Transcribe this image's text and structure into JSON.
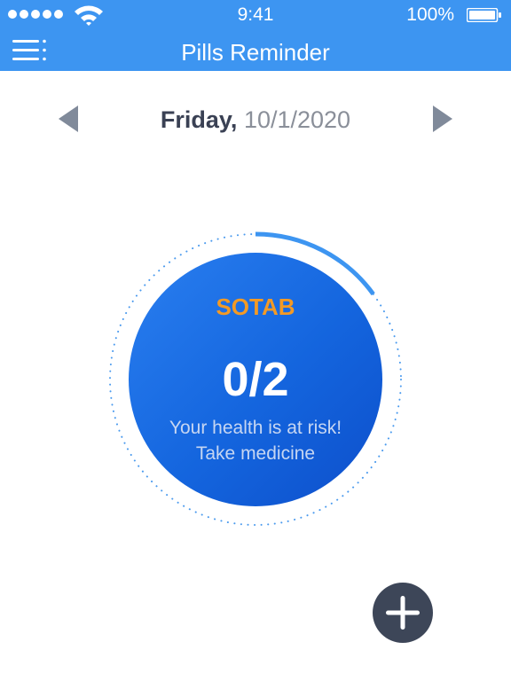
{
  "status_bar": {
    "time": "9:41",
    "battery": "100%"
  },
  "nav_bar": {
    "title": "Pills Reminder"
  },
  "date_nav": {
    "day": "Friday,",
    "date": "10/1/2020"
  },
  "pill_card": {
    "name": "SOTAB",
    "dose_count": "0/2",
    "warning_line_1": "Your health is at risk!",
    "warning_line_2": "Take medicine",
    "progress_fraction": 0.15
  },
  "colors": {
    "header": "#3d95f1",
    "pill_name": "#f39a25",
    "circle": "#1465de",
    "ring_progress": "#3d95f1",
    "add_button": "#3d4658"
  },
  "icons": {
    "menu": "menu-icon",
    "prev": "triangle-left-icon",
    "next": "triangle-right-icon",
    "add": "plus-icon"
  }
}
